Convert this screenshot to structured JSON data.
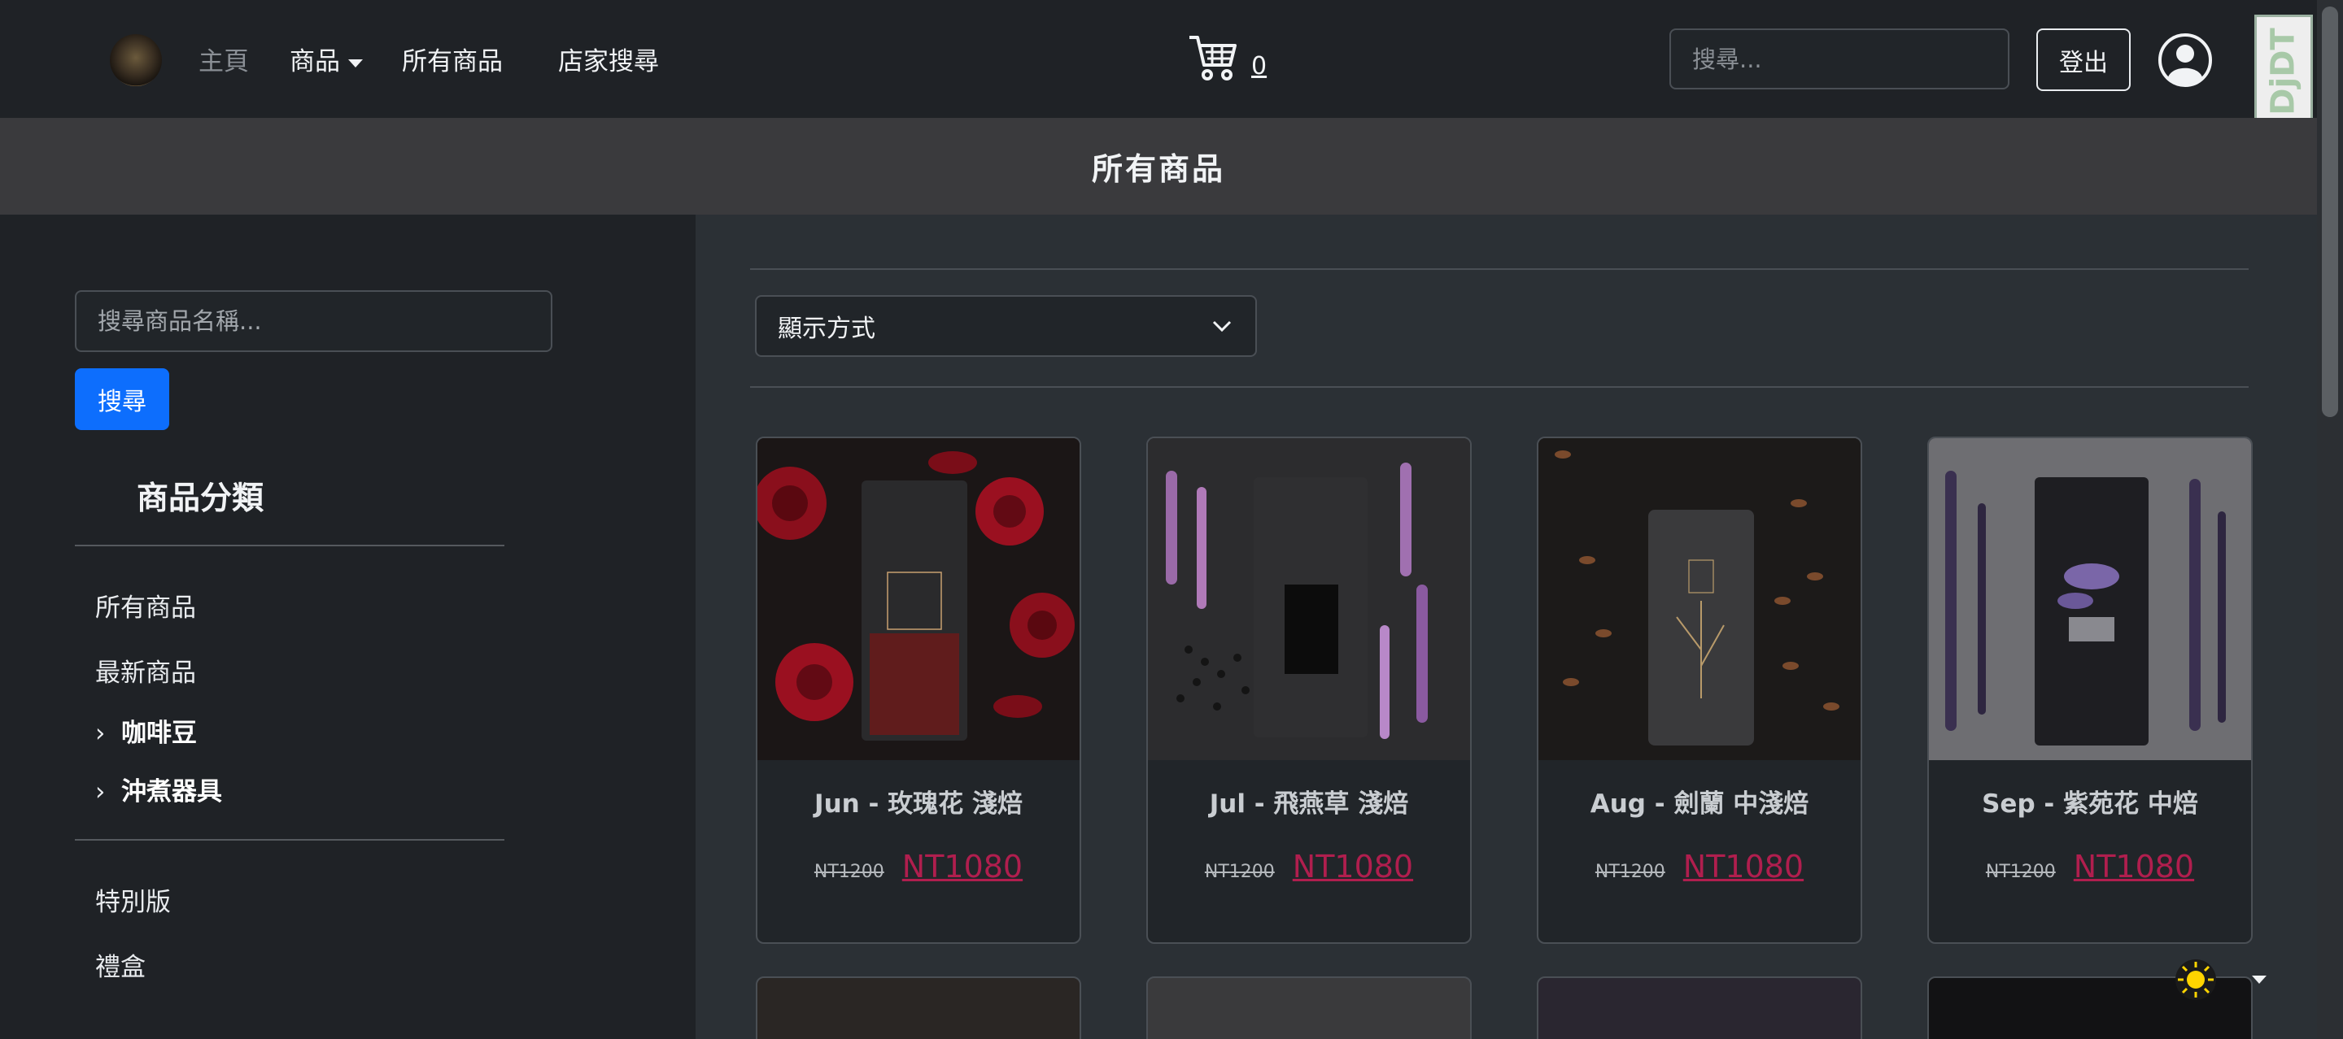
{
  "navbar": {
    "home_label": "主頁",
    "products_label": "商品",
    "all_products_label": "所有商品",
    "store_search_label": "店家搜尋",
    "cart_count": "0",
    "search_placeholder": "搜尋...",
    "logout_label": "登出",
    "debug_toolbar_label": "DjDT"
  },
  "page_title": "所有商品",
  "sidebar": {
    "search_placeholder": "搜尋商品名稱...",
    "search_button": "搜尋",
    "category_heading": "商品分類",
    "items_top": [
      "所有商品",
      "最新商品"
    ],
    "expandable": [
      "咖啡豆",
      "沖煮器具"
    ],
    "items_bottom": [
      "特別版",
      "禮盒"
    ]
  },
  "main": {
    "display_select": "顯示方式",
    "products": [
      {
        "title": "Jun - 玫瑰花 淺焙",
        "old_price": "NT1200",
        "price": "NT1080",
        "image": "rose-coffee-bag"
      },
      {
        "title": "Jul - 飛燕草 淺焙",
        "old_price": "NT1200",
        "price": "NT1080",
        "image": "larkspur-coffee-bag"
      },
      {
        "title": "Aug - 劍蘭 中淺焙",
        "old_price": "NT1200",
        "price": "NT1080",
        "image": "gladiolus-coffee-bag"
      },
      {
        "title": "Sep - 紫苑花 中焙",
        "old_price": "NT1200",
        "price": "NT1080",
        "image": "aster-coffee-bag"
      }
    ]
  },
  "colors": {
    "navbar_bg": "#1f2226",
    "title_band_bg": "#3a3a3d",
    "primary_button": "#0d6efd",
    "sale_price": "#b01e4e"
  }
}
